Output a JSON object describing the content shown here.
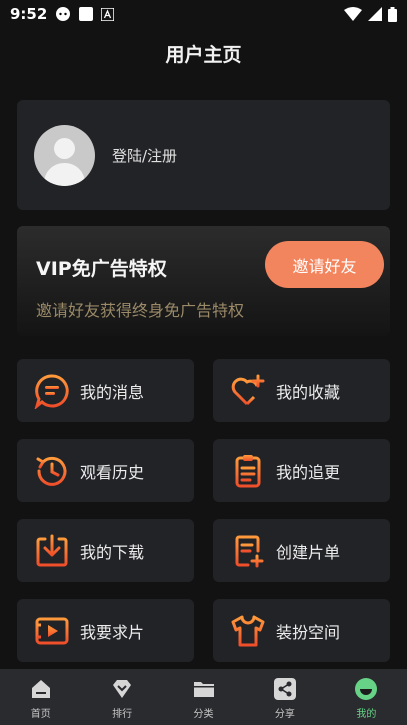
{
  "status_bar": {
    "time": "9:52"
  },
  "header": {
    "title": "用户主页"
  },
  "profile": {
    "login_label": "登陆/注册"
  },
  "vip": {
    "title": "VIP免广告特权",
    "subtitle": "邀请好友获得终身免广告特权",
    "invite_label": "邀请好友"
  },
  "menu": {
    "messages": "我的消息",
    "favorites": "我的收藏",
    "history": "观看历史",
    "updates": "我的追更",
    "download": "我的下载",
    "playlist": "创建片单",
    "request": "我要求片",
    "dressup": "装扮空间"
  },
  "tabs": [
    {
      "label": "首页"
    },
    {
      "label": "排行"
    },
    {
      "label": "分类"
    },
    {
      "label": "分享"
    },
    {
      "label": "我的"
    }
  ],
  "colors": {
    "accent": "#f3855e",
    "icon_gradient_start": "#f26b3a",
    "active_tab": "#67d387"
  }
}
